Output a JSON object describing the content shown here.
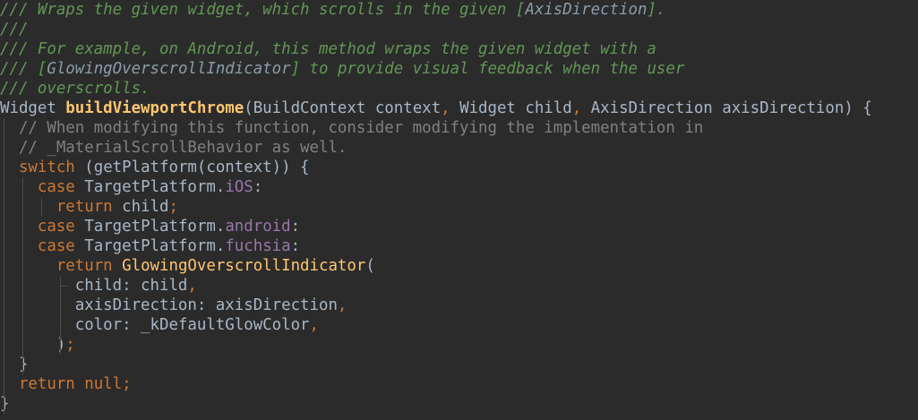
{
  "code_lines": [
    [
      [
        "/// Wraps the given widget, which scrolls in the given [",
        "doc"
      ],
      [
        "AxisDirection",
        "doc-ref"
      ],
      [
        "].",
        "doc"
      ]
    ],
    [
      [
        "///",
        "doc"
      ]
    ],
    [
      [
        "/// For example, on Android, this method wraps the given widget with a",
        "doc"
      ]
    ],
    [
      [
        "/// [",
        "doc"
      ],
      [
        "GlowingOverscrollIndicator",
        "doc-ref"
      ],
      [
        "] to provide visual feedback when the user",
        "doc"
      ]
    ],
    [
      [
        "/// overscrolls.",
        "doc"
      ]
    ],
    [
      [
        "Widget ",
        "plain"
      ],
      [
        "buildViewportChrome",
        "fn"
      ],
      [
        "(BuildContext context",
        "plain"
      ],
      [
        ", ",
        "kw"
      ],
      [
        "Widget child",
        "plain"
      ],
      [
        ", ",
        "kw"
      ],
      [
        "AxisDirection axisDirection) {",
        "plain"
      ]
    ],
    [
      [
        "  // When modifying this function, consider modifying the implementation in",
        "comment"
      ]
    ],
    [
      [
        "  // _MaterialScrollBehavior as well.",
        "comment"
      ]
    ],
    [
      [
        "  ",
        "plain"
      ],
      [
        "switch ",
        "kw"
      ],
      [
        "(getPlatform(context)) {",
        "plain"
      ]
    ],
    [
      [
        "    ",
        "plain"
      ],
      [
        "case ",
        "kw"
      ],
      [
        "TargetPlatform.",
        "plain"
      ],
      [
        "iOS",
        "field"
      ],
      [
        ":",
        "plain"
      ]
    ],
    [
      [
        "      ",
        "plain"
      ],
      [
        "return ",
        "kw"
      ],
      [
        "child",
        "plain"
      ],
      [
        ";",
        "kw"
      ]
    ],
    [
      [
        "    ",
        "plain"
      ],
      [
        "case ",
        "kw"
      ],
      [
        "TargetPlatform.",
        "plain"
      ],
      [
        "android",
        "field"
      ],
      [
        ":",
        "plain"
      ]
    ],
    [
      [
        "    ",
        "plain"
      ],
      [
        "case ",
        "kw"
      ],
      [
        "TargetPlatform.",
        "plain"
      ],
      [
        "fuchsia",
        "field"
      ],
      [
        ":",
        "plain"
      ]
    ],
    [
      [
        "      ",
        "plain"
      ],
      [
        "return ",
        "kw"
      ],
      [
        "GlowingOverscrollIndicator",
        "ctor"
      ],
      [
        "(",
        "plain"
      ]
    ],
    [
      [
        "        child: child",
        "plain"
      ],
      [
        ",",
        "kw"
      ]
    ],
    [
      [
        "        axisDirection: axisDirection",
        "plain"
      ],
      [
        ",",
        "kw"
      ]
    ],
    [
      [
        "        color: _kDefaultGlowColor",
        "plain"
      ],
      [
        ",",
        "kw"
      ]
    ],
    [
      [
        "      )",
        "plain"
      ],
      [
        ";",
        "kw"
      ]
    ],
    [
      [
        "  }",
        "plain"
      ]
    ],
    [
      [
        "  ",
        "plain"
      ],
      [
        "return null",
        "kw"
      ],
      [
        ";",
        "kw"
      ]
    ],
    [
      [
        "}",
        "plain"
      ]
    ]
  ],
  "colors": {
    "background": "#2b2b2b",
    "doc_comment": "#629755",
    "doc_reference": "#8a9da8",
    "keyword": "#cc7832",
    "function_declaration": "#ffc66d",
    "field": "#9876aa",
    "line_comment": "#808080",
    "default_text": "#a9b7c6"
  }
}
